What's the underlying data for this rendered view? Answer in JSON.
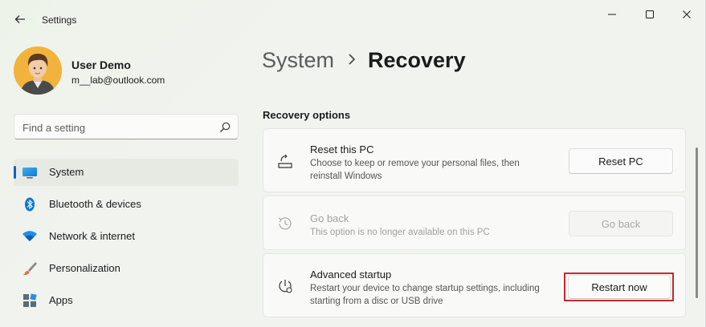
{
  "window": {
    "app_title": "Settings",
    "back_icon": "back-arrow-icon",
    "controls": [
      "minimize-icon",
      "maximize-icon",
      "close-icon"
    ]
  },
  "user": {
    "name": "User Demo",
    "email": "m__lab@outlook.com"
  },
  "search": {
    "placeholder": "Find a setting",
    "icon": "search-icon"
  },
  "sidebar": {
    "items": [
      {
        "label": "System",
        "icon": "monitor-icon",
        "active": true
      },
      {
        "label": "Bluetooth & devices",
        "icon": "bluetooth-icon",
        "active": false
      },
      {
        "label": "Network & internet",
        "icon": "wifi-icon",
        "active": false
      },
      {
        "label": "Personalization",
        "icon": "brush-icon",
        "active": false
      },
      {
        "label": "Apps",
        "icon": "apps-icon",
        "active": false
      }
    ]
  },
  "main": {
    "breadcrumb_parent": "System",
    "page_title": "Recovery",
    "section_title": "Recovery options",
    "cards": [
      {
        "title": "Reset this PC",
        "description": "Choose to keep or remove your personal files, then reinstall Windows",
        "button": "Reset PC",
        "icon": "reset-pc-icon",
        "enabled": true
      },
      {
        "title": "Go back",
        "description": "This option is no longer available on this PC",
        "button": "Go back",
        "icon": "history-icon",
        "enabled": false
      },
      {
        "title": "Advanced startup",
        "description": "Restart your device to change startup settings, including starting from a disc or USB drive",
        "button": "Restart now",
        "icon": "advanced-startup-icon",
        "enabled": true
      }
    ]
  },
  "colors": {
    "accent": "#0067c0",
    "highlight_border": "#c8262c"
  }
}
